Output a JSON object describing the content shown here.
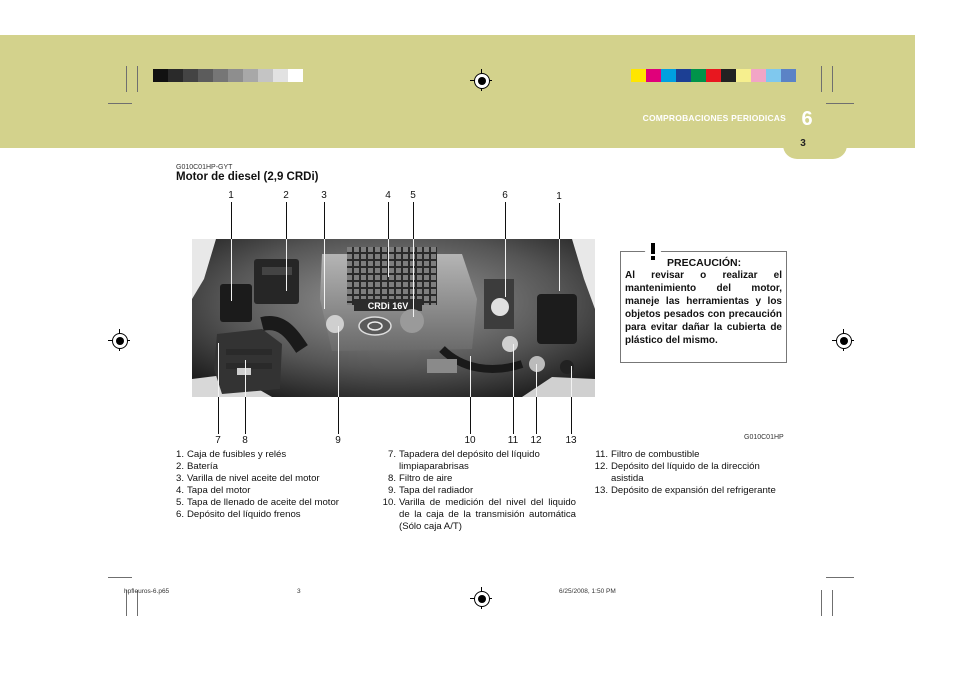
{
  "header": {
    "chapter_title": "COMPROBACIONES PERIODICAS",
    "chapter_number": "6",
    "page_number": "3"
  },
  "colors": {
    "band": "#d3d28c",
    "gray_swatches": [
      "#111111",
      "#2a2a2a",
      "#444444",
      "#5c5c5c",
      "#767676",
      "#8e8e8e",
      "#a8a8a8",
      "#c4c4c4",
      "#e2e2e2",
      "#ffffff"
    ],
    "color_swatches": [
      "#ffe600",
      "#e0007a",
      "#00a0e0",
      "#1c3f94",
      "#00934a",
      "#e8171f",
      "#222222",
      "#f6ef8e",
      "#f2a5c6",
      "#7fc8ee",
      "#5b83c6"
    ]
  },
  "section": {
    "code": "G010C01HP-GYT",
    "title": "Motor de diesel (2,9 CRDi)"
  },
  "figure": {
    "code": "G010C01HP",
    "engine_label": "CRDi 16V",
    "callouts_top": [
      "1",
      "2",
      "3",
      "4",
      "5",
      "6",
      "1"
    ],
    "callouts_bottom": [
      "7",
      "8",
      "9",
      "10",
      "11",
      "12",
      "13"
    ]
  },
  "legend": {
    "col1": [
      {
        "n": "1.",
        "text": "Caja de fusibles y relés"
      },
      {
        "n": "2.",
        "text": "Batería"
      },
      {
        "n": "3.",
        "text": "Varilla de nivel aceite del motor"
      },
      {
        "n": "4.",
        "text": "Tapa del motor"
      },
      {
        "n": "5.",
        "text": "Tapa de llenado de aceite del motor"
      },
      {
        "n": "6.",
        "text": "Depósito del líquido frenos"
      }
    ],
    "col2": [
      {
        "n": "7.",
        "text": "Tapadera del depósito del líquido limpiaparabrisas"
      },
      {
        "n": "8.",
        "text": "Filtro de aire"
      },
      {
        "n": "9.",
        "text": "Tapa del radiador"
      },
      {
        "n": "10.",
        "text": "Varilla de medición del nivel del liquido de la caja de la transmisión automática (Sólo caja A/T)"
      }
    ],
    "col3": [
      {
        "n": "11.",
        "text": "Filtro de combustible"
      },
      {
        "n": "12.",
        "text": "Depósito del líquido de la dirección asistida"
      },
      {
        "n": "13.",
        "text": "Depósito de expansión del refrigerante"
      }
    ]
  },
  "warning": {
    "title": "PRECAUCIÓN:",
    "text": "Al revisar o realizar el mantenimiento del motor, maneje las herramientas y los objetos pesados con precaución para evitar dañar la cubierta de plástico del mismo.",
    "icon": "warning-triangle-icon"
  },
  "footer": {
    "file": "hpfleuros-6.p65",
    "page": "3",
    "timestamp": "6/25/2008, 1:50 PM"
  }
}
